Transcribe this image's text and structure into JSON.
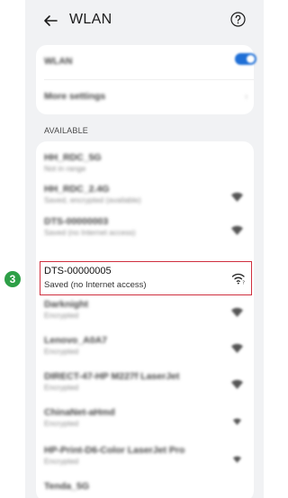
{
  "header": {
    "title": "WLAN",
    "back_icon": "arrow-left-icon",
    "help_icon": "question-circle-icon"
  },
  "top_card": {
    "wlan_label": "WLAN",
    "more_settings_label": "More settings"
  },
  "section_label": "AVAILABLE",
  "networks": [
    {
      "name": "HH_RDC_5G",
      "status": "Not in range",
      "icon": ""
    },
    {
      "name": "HH_RDC_2.4G",
      "status": "Saved, encrypted (available)",
      "icon": "wifi-lock-icon"
    },
    {
      "name": "DTS-00000003",
      "status": "Saved (no Internet access)",
      "icon": "wifi-question-icon"
    },
    {
      "name": "DTS-00000005",
      "status": "Saved (no Internet access)",
      "icon": "wifi-question-icon"
    },
    {
      "name": "Darknight",
      "status": "Encrypted",
      "icon": "wifi-lock-icon"
    },
    {
      "name": "Lenovo_A0A7",
      "status": "Encrypted",
      "icon": "wifi-lock-icon"
    },
    {
      "name": "DIRECT-47-HP M227f LaserJet",
      "status": "Encrypted",
      "icon": "wifi-lock-icon"
    },
    {
      "name": "ChinaNet-aHmd",
      "status": "Encrypted",
      "icon": "wifi-lock-icon"
    },
    {
      "name": "HP-Print-D6-Color LaserJet Pro",
      "status": "Encrypted",
      "icon": "wifi-lock-icon"
    },
    {
      "name": "Tenda_5G",
      "status": "",
      "icon": "wifi-lock-icon"
    }
  ],
  "highlight": {
    "name": "DTS-00000005",
    "status": "Saved (no Internet access)",
    "step": "3"
  },
  "colors": {
    "toggle": "#1f6fd6",
    "highlight_border": "#d0303f",
    "step_badge": "#2e9f47"
  }
}
